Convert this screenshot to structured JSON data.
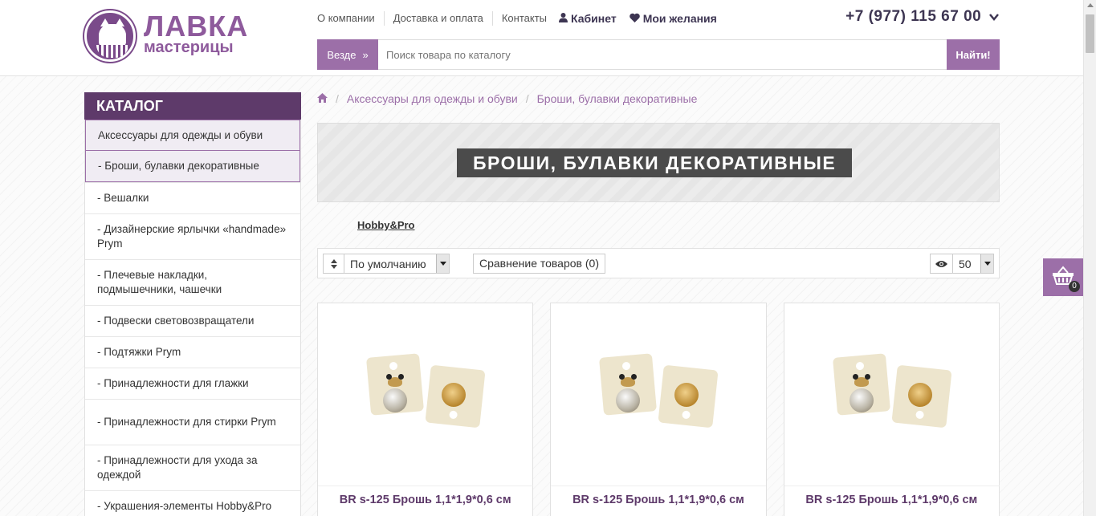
{
  "logo": {
    "title": "ЛАВКА",
    "subtitle": "мастерицы"
  },
  "topnav": {
    "about": "О компании",
    "delivery": "Доставка и оплата",
    "contacts": "Контакты",
    "cabinet": "Кабинет",
    "wishlist": "Мои желания"
  },
  "phone": "+7 (977) 115 67 00",
  "search": {
    "scope": "Везде",
    "placeholder": "Поиск товара по каталогу",
    "button": "Найти!"
  },
  "catalog": {
    "title": "КАТАЛОГ",
    "items": [
      {
        "label": "Аксессуары для одежды и обуви",
        "state": "parent"
      },
      {
        "label": "- Броши, булавки декоративные",
        "state": "active"
      },
      {
        "label": "- Вешалки",
        "state": ""
      },
      {
        "label": "- Дизайнерские ярлычки «handmade» Prym",
        "state": ""
      },
      {
        "label": "- Плечевые накладки, подмышечники, чашечки",
        "state": ""
      },
      {
        "label": "- Подвески световозвращатели",
        "state": ""
      },
      {
        "label": "- Подтяжки Prym",
        "state": ""
      },
      {
        "label": "- Принадлежности для глажки",
        "state": ""
      },
      {
        "label": "- Принадлежности для стирки Prym",
        "state": ""
      },
      {
        "label": "- Принадлежности для ухода за одеждой",
        "state": ""
      },
      {
        "label": "- Украшения-элементы Hobby&Pro",
        "state": ""
      }
    ]
  },
  "breadcrumbs": {
    "level1": "Аксессуары для одежды и обуви",
    "level2": "Броши, булавки декоративные"
  },
  "page_title": "БРОШИ, БУЛАВКИ ДЕКОРАТИВНЫЕ",
  "brand_link": "Hobby&Pro",
  "toolbar": {
    "sort": "По умолчанию",
    "compare": "Сравнение товаров (0)",
    "per_page": "50"
  },
  "products": [
    {
      "name": "BR s-125 Брошь 1,1*1,9*0,6 см"
    },
    {
      "name": "BR s-125 Брошь 1,1*1,9*0,6 см"
    },
    {
      "name": "BR s-125 Брошь 1,1*1,9*0,6 см"
    }
  ],
  "cart": {
    "count": "0"
  },
  "colors": {
    "accent": "#9c6fa8",
    "dark_accent": "#5e3a6a"
  }
}
